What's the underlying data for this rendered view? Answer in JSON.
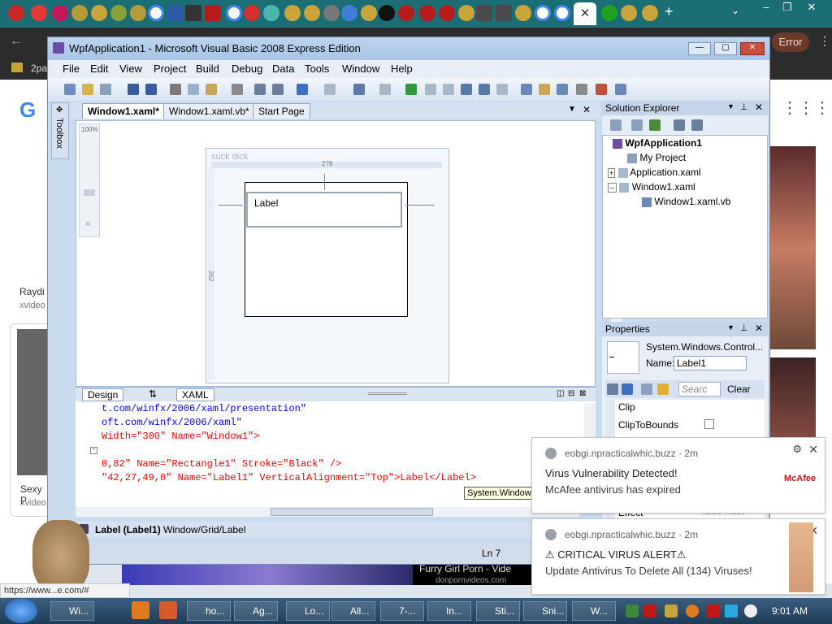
{
  "browser": {
    "error_label": "Error",
    "bookmark_text": "2pa",
    "status_url": "https://www...e.com/#"
  },
  "page_bg_items": [
    {
      "title": "Raydi",
      "source": "xvideo"
    },
    {
      "title": "Sexy P",
      "source": "xvideo"
    }
  ],
  "video_caption": {
    "title": "Furry Girl Porn - Vide",
    "source": "donpornvideos.com"
  },
  "vs": {
    "title": "WpfApplication1 - Microsoft Visual Basic 2008 Express Edition",
    "menu": [
      "File",
      "Edit",
      "View",
      "Project",
      "Build",
      "Debug",
      "Data",
      "Tools",
      "Window",
      "Help"
    ],
    "doc_tabs": [
      "Window1.xaml*",
      "Window1.xaml.vb*",
      "Start Page"
    ],
    "toolbox_label": "Toolbox",
    "zoom": "100%",
    "designer": {
      "window_title": "suck dick",
      "width_marker": "278",
      "height_marker": "262",
      "label_text": "Label"
    },
    "split_tabs": {
      "design": "Design",
      "swap": "⇅",
      "xaml": "XAML"
    },
    "xaml_lines": [
      "t.com/winfx/2006/xaml/presentation\"",
      "oft.com/winfx/2006/xaml\"",
      "Width=\"300\" Name=\"Window1\">",
      "0,82\" Name=\"Rectangle1\" Stroke=\"Black\" />",
      "\"42,27,49,0\" Name=\"Label1\" VerticalAlignment=\"Top\">Label</Label>"
    ],
    "tooltip": "System.Window",
    "breadcrumb": {
      "current": "Label (Label1)",
      "path": "Window/Grid/Label"
    },
    "status": {
      "line": "Ln 7"
    }
  },
  "solution_explorer": {
    "title": "Solution Explorer",
    "items": [
      {
        "label": "WpfApplication1",
        "bold": true
      },
      {
        "label": "My Project"
      },
      {
        "label": "Application.xaml"
      },
      {
        "label": "Window1.xaml"
      },
      {
        "label": "Window1.xaml.vb"
      }
    ]
  },
  "properties": {
    "title": "Properties",
    "type": "System.Windows.Control...",
    "name_label": "Name:",
    "name_value": "Label1",
    "search_placeholder": "Searc",
    "clear": "Clear",
    "rows": [
      {
        "label": "Clip",
        "value": ""
      },
      {
        "label": "ClipToBounds",
        "value": ""
      },
      {
        "label": "Effect",
        "value": "Value must"
      }
    ]
  },
  "notifications": [
    {
      "source": "eobgi.npracticalwhic.buzz · 2m",
      "title": "Virus Vulnerability Detected!",
      "body": "McAfee antivirus has expired",
      "brand": "McAfee"
    },
    {
      "source": "eobgi.npracticalwhic.buzz · 2m",
      "title": "⚠ CRITICAL VIRUS ALERT⚠",
      "body": "Update Antivirus To Delete All (134) Viruses!",
      "brand": ""
    }
  ],
  "taskbar": {
    "items": [
      "Wi...",
      "",
      "ho...",
      "Ag...",
      "Lo...",
      "All...",
      "7-...",
      "In...",
      "Sti...",
      "Sni...",
      "W..."
    ],
    "clock": "9:01 AM"
  },
  "colors": {
    "tabstrip": "#1b6e73",
    "vs_frame": "#c9dbee",
    "taskbar": "#1f3b57"
  }
}
